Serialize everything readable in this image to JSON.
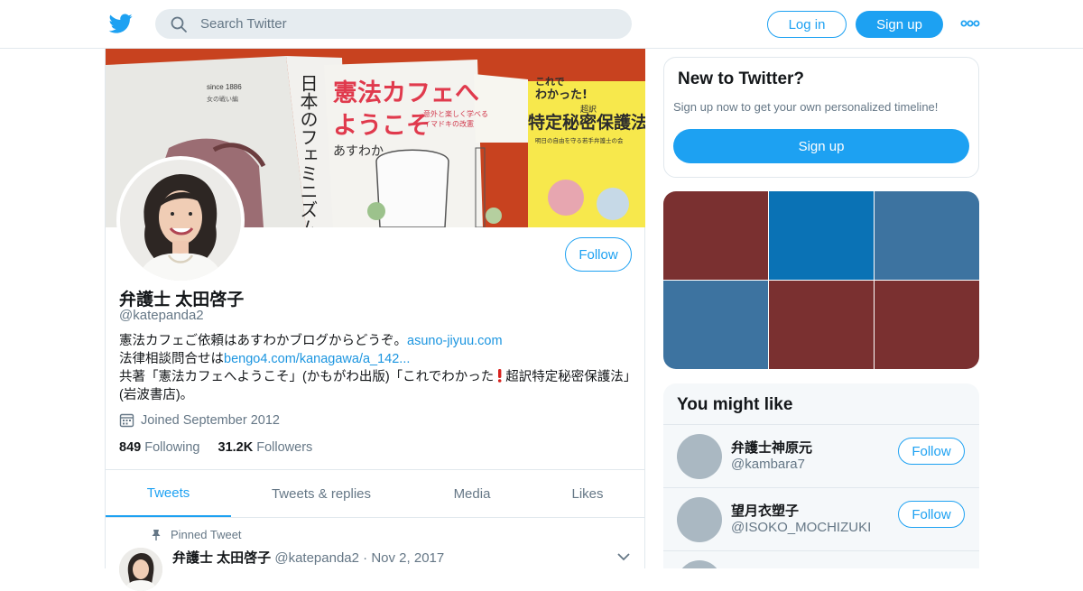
{
  "header": {
    "search_placeholder": "Search Twitter",
    "login_label": "Log in",
    "signup_label": "Sign up"
  },
  "profile": {
    "follow_label": "Follow",
    "name": "弁護士 太田啓子",
    "handle": "@katepanda2",
    "bio": {
      "line1_text": "憲法カフェご依頼はあすわかブログからどうぞ。",
      "line1_link": "asuno-jiyuu.com",
      "line2_text": "法律相談問合せは",
      "line2_link": "bengo4.com/kanagawa/a_142...",
      "line3_text": "共著「憲法カフェへようこそ」(かもがわ出版)「これでわかった",
      "line3_text_b": "超訳特定秘密保護法」(岩波書店)。"
    },
    "joined": "Joined September 2012",
    "following_count": "849",
    "following_label": "Following",
    "followers_count": "31.2K",
    "followers_label": "Followers",
    "banner_texts": {
      "book1_small": "since 1886",
      "book1_sub": "女の戦い編",
      "book1_vertical": "日本のフェミニズム",
      "book2_title1": "憲法カフェへ",
      "book2_title2": "ようこそ",
      "book2_sub1": "意外と楽しく学べる",
      "book2_sub2": "イマドキの改憲",
      "book2_author": "あすわか",
      "book3_top1": "これで",
      "book3_top2": "わかった!",
      "book3_tag": "超訳",
      "book3_title": "特定秘密保護法",
      "book3_sub": "明日の自由を守る若手弁護士の会"
    }
  },
  "tabs": [
    "Tweets",
    "Tweets & replies",
    "Media",
    "Likes"
  ],
  "pinned": {
    "label": "Pinned Tweet",
    "name": "弁護士 太田啓子",
    "handle": "@katepanda2",
    "separator": "·",
    "date": "Nov 2, 2017"
  },
  "new_to_twitter": {
    "title": "New to Twitter?",
    "desc": "Sign up now to get your own personalized timeline!",
    "button": "Sign up"
  },
  "media_colors": [
    "#7a3030",
    "#0a72b5",
    "#3d73a0",
    "#3d73a0",
    "#7a3030",
    "#7a3030"
  ],
  "you_might_like": {
    "title": "You might like",
    "items": [
      {
        "name": "弁護士神原元",
        "handle": "@kambara7",
        "button": "Follow"
      },
      {
        "name": "望月衣塑子",
        "handle": "@ISOKO_MOCHIZUKI",
        "button": "Follow"
      }
    ]
  },
  "colors": {
    "accent": "#1da1f2",
    "link": "#1b95e0",
    "muted": "#657786"
  }
}
